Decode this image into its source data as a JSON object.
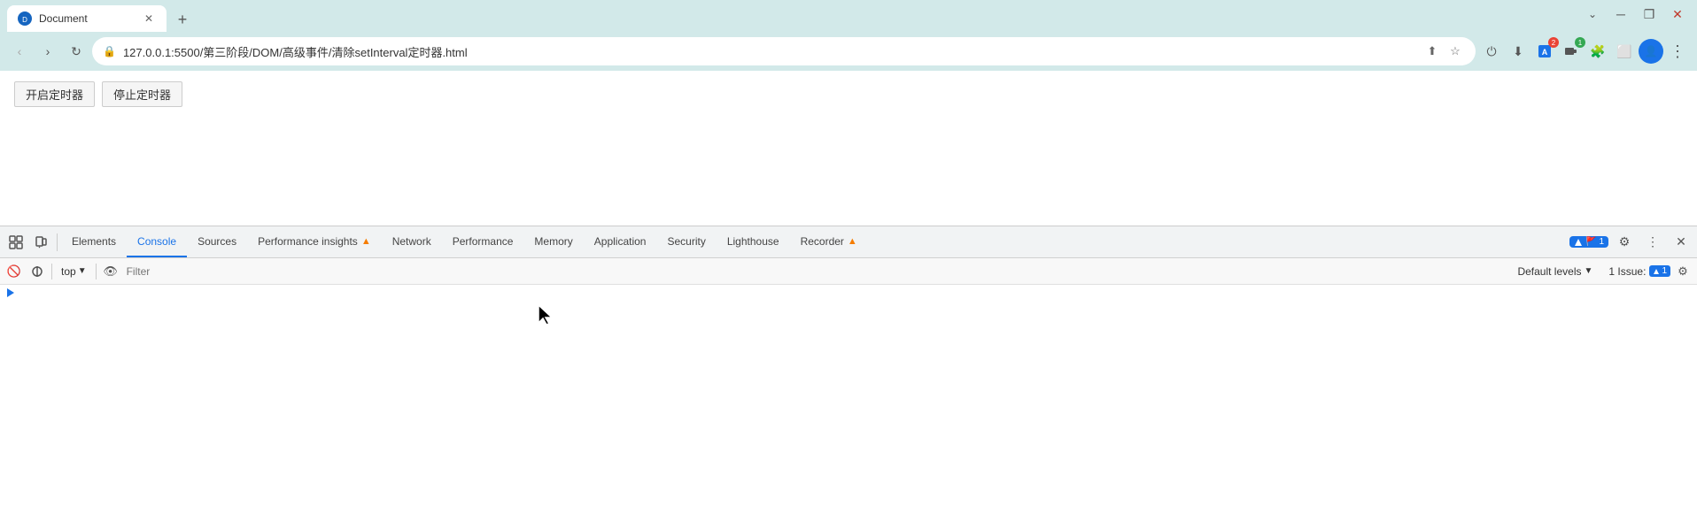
{
  "browser": {
    "tab": {
      "title": "Document",
      "favicon": "D"
    },
    "address": "127.0.0.1:5500/第三阶段/DOM/高级事件/清除setInterval定时器.html",
    "nav": {
      "back": "‹",
      "forward": "›",
      "reload": "↻"
    }
  },
  "page": {
    "btn1": "开启定时器",
    "btn2": "停止定时器"
  },
  "devtools": {
    "tabs": [
      {
        "id": "elements",
        "label": "Elements",
        "active": false
      },
      {
        "id": "console",
        "label": "Console",
        "active": true
      },
      {
        "id": "sources",
        "label": "Sources",
        "active": false
      },
      {
        "id": "performance-insights",
        "label": "Performance insights",
        "active": false,
        "has_icon": true
      },
      {
        "id": "network",
        "label": "Network",
        "active": false
      },
      {
        "id": "performance",
        "label": "Performance",
        "active": false
      },
      {
        "id": "memory",
        "label": "Memory",
        "active": false
      },
      {
        "id": "application",
        "label": "Application",
        "active": false
      },
      {
        "id": "security",
        "label": "Security",
        "active": false
      },
      {
        "id": "lighthouse",
        "label": "Lighthouse",
        "active": false
      },
      {
        "id": "recorder",
        "label": "Recorder",
        "active": false,
        "has_icon": true
      }
    ],
    "issues_badge": "1",
    "toolbar_right": {
      "settings": "⚙",
      "more": "⋮",
      "close": "✕"
    }
  },
  "console_toolbar": {
    "top_label": "top",
    "filter_placeholder": "Filter",
    "default_levels": "Default levels",
    "issues_label": "1 Issue:",
    "issues_count": "1"
  }
}
